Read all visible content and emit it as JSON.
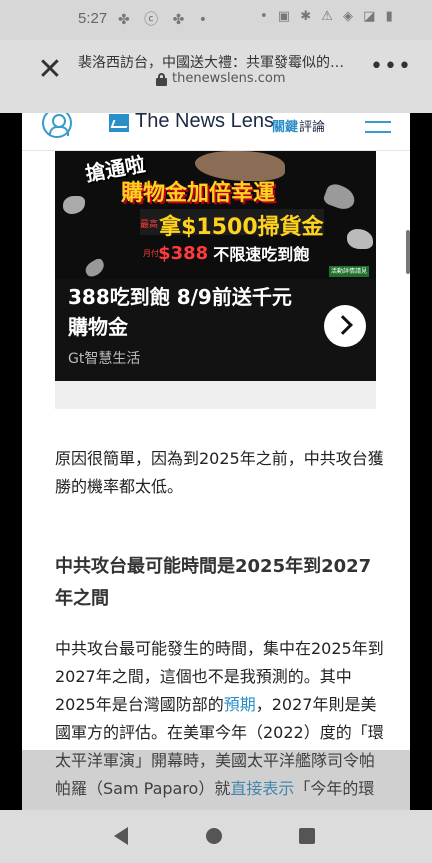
{
  "status_bar": {
    "time": "5:27",
    "left_icons": "✤ ⓒ ✤ •",
    "right_icons": "• ▣ ✱ ⚠ ◈ ◪ ▮"
  },
  "tab_bar": {
    "title": "裴洛西訪台，中國送大禮：共軍發霉似的…",
    "domain": "thenewslens.com"
  },
  "site_header": {
    "logo": "The News Lens",
    "logo_sub_accent": "關鍵",
    "logo_sub": "評論"
  },
  "ad": {
    "burst_text": "搶通啦",
    "headline": "購物金加倍幸運",
    "line2_tag": "最高",
    "line2_amount": "拿$1500掃貨金",
    "line3_tag": "月付",
    "line3_price": "$388",
    "line3_text": "不限速吃到飽",
    "badge": "活動詳情請見",
    "caption": "388吃到飽 8/9前送千元購物金",
    "sponsor": "Gt智慧生活"
  },
  "article": {
    "para1": "原因很簡單，因為到2025年之前，中共攻台獲勝的機率都太低。",
    "heading": "中共攻台最可能時間是2025年到2027年之間",
    "para2_a": "中共攻台最可能發生的時間，集中在2025年到2027年之間，這個也不是我預測的。其中2025年是台灣國防部的",
    "para2_link": "預期",
    "para2_b": "，2027年則是美國軍方的評估。在美軍今年（2022）度的「環太平洋軍演」開幕時，美國太平洋艦隊司令帕帕羅（Sam Paparo）就",
    "para2_link2": "直接表示",
    "para2_c": "「今年的環"
  }
}
